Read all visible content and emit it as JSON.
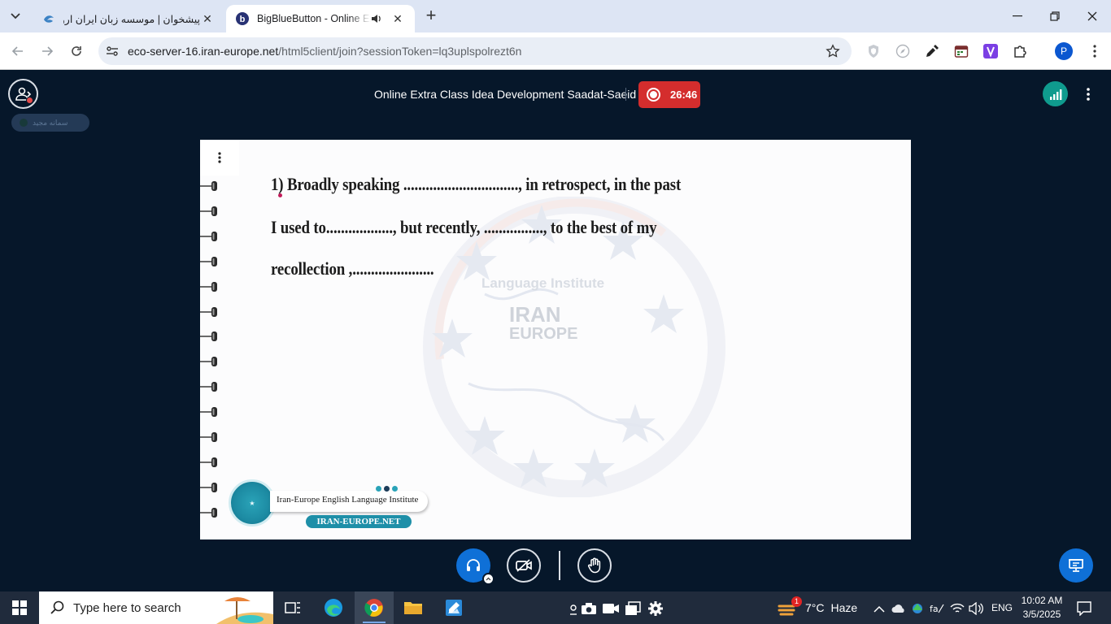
{
  "browser": {
    "tabs": [
      {
        "title": "پیشخوان | موسسه زبان ایران اروپا",
        "active": false
      },
      {
        "title": "BigBlueButton - Online Extra",
        "active": true,
        "audio": true
      }
    ],
    "url_host": "eco-server-16.iran-europe.net",
    "url_path": "/html5client/join?sessionToken=lq3uplspolrezt6n",
    "profile_initial": "P",
    "new_tab_symbol": "+"
  },
  "bbb": {
    "talking_indicator": "سمانه مجید",
    "meeting_title": "Online Extra Class Idea Development Saadat-Saeid",
    "recording_time": "26:46",
    "slide": {
      "lines": [
        "1) Broadly speaking ..............................., in retrospect, in the past",
        "I used to.................., but recently, ................, to the best of my",
        "recollection ,......................"
      ],
      "watermark_label": "Language Institute",
      "watermark_iran": "IRAN",
      "watermark_europe": "EUROPE",
      "logo_name": "Iran-Europe English Language Institute",
      "logo_url": "IRAN-EUROPE.NET"
    }
  },
  "taskbar": {
    "search_placeholder": "Type here to search",
    "weather_badge": "1",
    "weather_temp": "7°C",
    "weather_desc": "Haze",
    "language": "ENG",
    "time": "10:02 AM",
    "date": "3/5/2025"
  },
  "colors": {
    "bbb_background": "#06172a",
    "recording": "#d42d2d",
    "primary_button": "#0f70d7",
    "connection": "#0f9b8e",
    "taskbar": "#202b3c",
    "tabstrip": "#dde5f4"
  }
}
